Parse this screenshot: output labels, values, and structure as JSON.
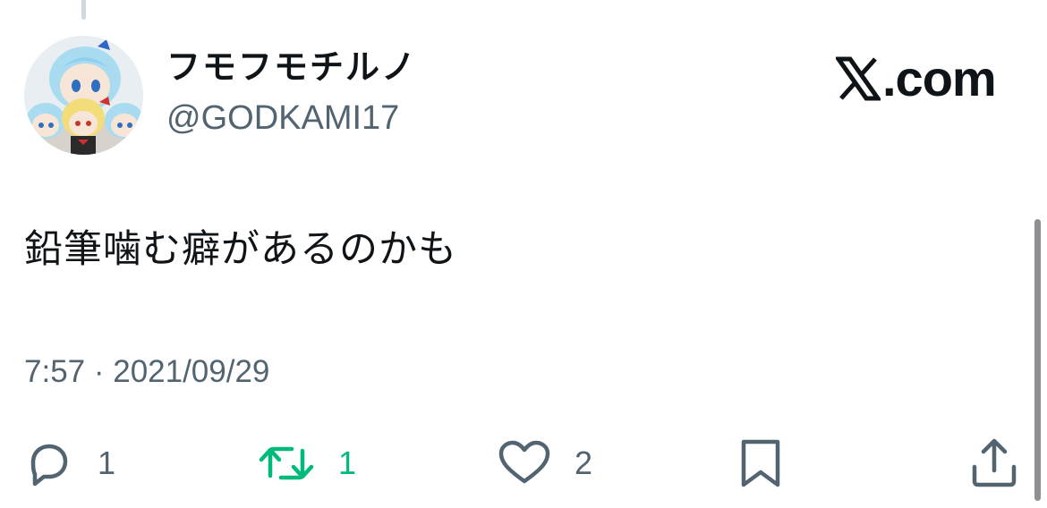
{
  "tweet": {
    "author": {
      "display_name": "フモフモチルノ",
      "handle": "@GODKAMI17",
      "avatar": "plush-dolls-avatar"
    },
    "brand": {
      "icon": "x-logo-icon",
      "text": ".com"
    },
    "text": "鉛筆噛む癖があるのかも",
    "timestamp": "7:57 · 2021/09/29",
    "actions": {
      "reply": {
        "icon": "reply-icon",
        "count": "1"
      },
      "retweet": {
        "icon": "retweet-icon",
        "count": "1",
        "color": "#00ba7c"
      },
      "like": {
        "icon": "heart-icon",
        "count": "2"
      },
      "bookmark": {
        "icon": "bookmark-icon"
      },
      "share": {
        "icon": "share-icon"
      }
    }
  },
  "colors": {
    "text_primary": "#0f1419",
    "text_secondary": "#536471",
    "retweet_green": "#00ba7c"
  }
}
